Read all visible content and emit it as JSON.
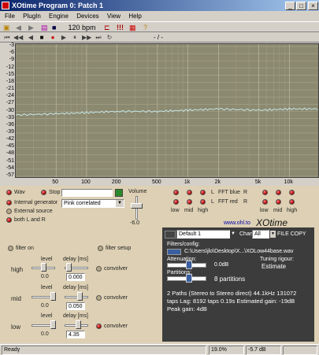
{
  "window": {
    "title": "XOtime Program 0: Patch   1",
    "min": "_",
    "max": "□",
    "close": "×"
  },
  "menu": [
    "File",
    "PlugIn",
    "Engine",
    "Devices",
    "View",
    "Help"
  ],
  "toolbar": {
    "bpm": "120 bpm",
    "bang": "!!!",
    "position_label": "- / -"
  },
  "chart": {
    "y_ticks": [
      "-3",
      "-6",
      "-9",
      "-12",
      "-15",
      "-18",
      "-21",
      "-24",
      "-27",
      "-30",
      "-33",
      "-36",
      "-39",
      "-42",
      "-45",
      "-48",
      "-51",
      "-54",
      "-57"
    ],
    "x_ticks": [
      "50",
      "100",
      "200",
      "500",
      "1k",
      "2k",
      "5k",
      "10k"
    ]
  },
  "chart_data": {
    "type": "line",
    "ylim": [
      -58,
      -2
    ],
    "x": [
      20,
      50,
      100,
      200,
      500,
      1000,
      2000,
      5000,
      10000,
      20000
    ],
    "series": [
      {
        "values": [
          -31.5,
          -31,
          -30.5,
          -30,
          -30,
          -29.5,
          -29,
          -29.5,
          -29,
          -29
        ]
      }
    ]
  },
  "source": {
    "wav_label": "Wav",
    "stop_label": "Stop",
    "internal_label": "Internal generator",
    "external_label": "External source",
    "both_label": "both L and R",
    "noise_select": "Pink correlated",
    "volume_label": "Volume",
    "volume_value": "-6.0"
  },
  "fft": {
    "l_label": "L",
    "blue_label": "FFT blue",
    "r_label": "R",
    "red_label": "FFT red",
    "low": "low",
    "mid": "mid",
    "high": "high",
    "url": "www.ohl.to"
  },
  "filter": {
    "on_label": "filter on",
    "setup_label": "filter setup",
    "level_label": "level",
    "delay_label": "delay [ms]",
    "convolver_label": "convolver",
    "bands": [
      {
        "name": "high",
        "level": "0.0",
        "delay": "0.000"
      },
      {
        "name": "mid",
        "level": "0.0",
        "delay": "0.050"
      },
      {
        "name": "low",
        "level": "0.0",
        "delay": "4.35"
      }
    ]
  },
  "xo": {
    "preset": "Default 1",
    "chan_label": "Chan",
    "chan_value": "All",
    "file_copy": "FILE COPY",
    "brand": "XOtime",
    "filters_label": "Filters/config:",
    "file_path": "C:\\Users\\jlo\\Desktop\\X...\\XOLow44base.wav",
    "attenuation_label": "Attenuation:",
    "attenuation_value": "0.0dB",
    "tuning_label": "Tuning rigour:",
    "tuning_value": "Estimate",
    "partitions_label": "Partitions:",
    "partitions_value": "8 partitions",
    "info1": "2 Paths (Stereo to Stereo direct) 44.1kHz 131072",
    "info2": "taps Lag: 8192 taps 0.19s Estimated gain: -19dB",
    "info3": "Peak gain: 4dB"
  },
  "status": {
    "ready": "Ready",
    "cpu": "19.0%",
    "level": "-5.7 dB"
  }
}
